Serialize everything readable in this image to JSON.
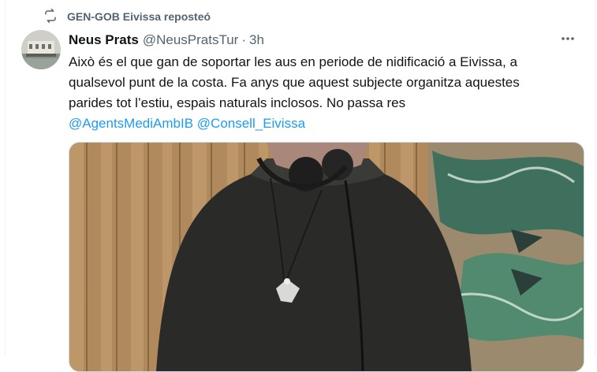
{
  "repost": {
    "icon": "repost-icon",
    "text": "GEN-GOB Eivissa reposteó"
  },
  "author": {
    "avatar": "avatar",
    "name": "Neus Prats",
    "handle": "@NeusPratsTur",
    "separator": "·",
    "time": "3h"
  },
  "more": {
    "icon": "more-icon",
    "label": "···"
  },
  "tweet": {
    "line1": "Això és el que gan de soportar les aus en periode de nidificació a Eivissa, a",
    "line2": "qualsevol punt de la costa. Fa anys que aquest subjecte organitza aquestes",
    "line3": "parides tot l’estiu, espais naturals inclosos. No passa res",
    "mention1": "@AgentsMediAmbIB",
    "mention2": "@Consell_Eivissa"
  },
  "colors": {
    "accent": "#1d9bf0",
    "secondary_text": "#536471",
    "primary_text": "#0f1419"
  }
}
